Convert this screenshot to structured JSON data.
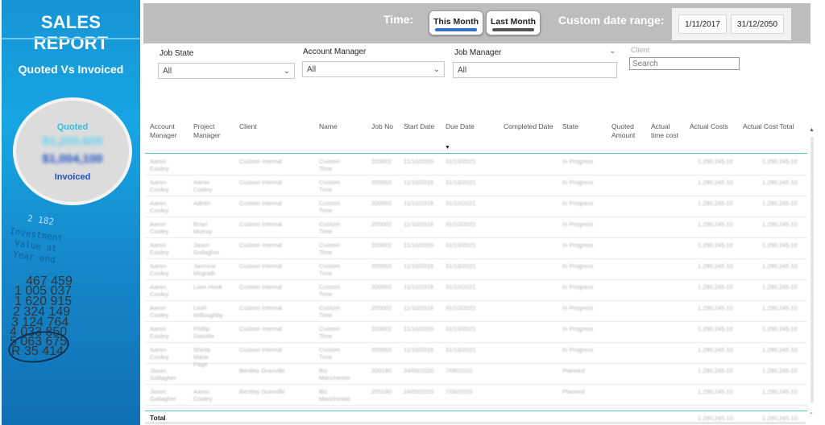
{
  "sidebar": {
    "title": "SALES REPORT",
    "subtitle": "Quoted Vs Invoiced",
    "kpi": {
      "quoted_label": "Quoted",
      "quoted_value": "$1,200,600",
      "invoiced_value": "$1,004,100",
      "invoiced_label": "Invoiced"
    },
    "deco_text": [
      "2 182",
      "Investment",
      "Value at",
      "Year end"
    ],
    "deco_numbers": [
      "467 459",
      "1 005 037",
      "1 620 915",
      "2 324 149",
      "3 124 764",
      "4 033 850",
      "5 063 675",
      "R 35 414"
    ]
  },
  "header": {
    "time_label": "Time:",
    "this_month": "This Month",
    "last_month": "Last Month",
    "custom_label": "Custom date range:",
    "date_from": "1/11/2017",
    "date_to": "31/12/2050"
  },
  "slicers": {
    "job_state": {
      "label": "Job State",
      "value": "All"
    },
    "account_manager": {
      "label": "Account Manager",
      "value": "All"
    },
    "job_manager": {
      "label": "Job Manager",
      "value": "All"
    },
    "client": {
      "label": "Client",
      "placeholder": "Search"
    }
  },
  "table": {
    "columns": [
      "Account Manager",
      "Project Manager",
      "Client",
      "Name",
      "Job No",
      "Start Date",
      "Due Date",
      "Completed Date",
      "State",
      "Quoted Amount",
      "Actual time cost",
      "Actual Costs",
      "Actual Cost Total"
    ],
    "rows": [
      [
        "Aaron Cooley",
        "",
        "Custom Internal",
        "Custom Time",
        "200002",
        "11/10/2016",
        "31/10/2021",
        "",
        "In Progress",
        "",
        "",
        "1,290,245.10",
        "1,290,245.10"
      ],
      [
        "Aaron Cooley",
        "Aaron Cooley",
        "Custom Internal",
        "Custom Time",
        "200002",
        "11/10/2016",
        "31/10/2021",
        "",
        "In Progress",
        "",
        "",
        "1,290,245.10",
        "1,290,245.10"
      ],
      [
        "Aaron Cooley",
        "Admin",
        "Custom Internal",
        "Custom Time",
        "200002",
        "11/10/2016",
        "31/10/2021",
        "",
        "In Progress",
        "",
        "",
        "1,290,245.10",
        "1,290,245.10"
      ],
      [
        "Aaron Cooley",
        "Brian Murray",
        "Custom Internal",
        "Custom Time",
        "200002",
        "11/10/2016",
        "31/10/2021",
        "",
        "In Progress",
        "",
        "",
        "1,290,245.10",
        "1,290,245.10"
      ],
      [
        "Aaron Cooley",
        "Jason Gallagher",
        "Custom Internal",
        "Custom Time",
        "200002",
        "11/10/2016",
        "31/10/2021",
        "",
        "In Progress",
        "",
        "",
        "1,290,245.10",
        "1,290,245.10"
      ],
      [
        "Aaron Cooley",
        "Jasmine Mcgrath",
        "Custom Internal",
        "Custom Time",
        "200002",
        "11/10/2016",
        "31/10/2021",
        "",
        "In Progress",
        "",
        "",
        "1,290,245.10",
        "1,290,245.10"
      ],
      [
        "Aaron Cooley",
        "Liam Hook",
        "Custom Internal",
        "Custom Time",
        "200002",
        "11/10/2016",
        "31/10/2021",
        "",
        "In Progress",
        "",
        "",
        "1,290,245.10",
        "1,290,245.10"
      ],
      [
        "Aaron Cooley",
        "Leah Willoughby",
        "Custom Internal",
        "Custom Time",
        "200002",
        "11/10/2016",
        "31/10/2021",
        "",
        "In Progress",
        "",
        "",
        "1,290,245.10",
        "1,290,245.10"
      ],
      [
        "Aaron Cooley",
        "Phillip Dakotla",
        "Custom Internal",
        "Custom Time",
        "200002",
        "11/10/2016",
        "31/10/2021",
        "",
        "In Progress",
        "",
        "",
        "1,290,245.10",
        "1,290,245.10"
      ],
      [
        "Aaron Cooley",
        "Sheila Marie Page",
        "Custom Internal",
        "Custom Time",
        "200002",
        "11/10/2016",
        "31/10/2021",
        "",
        "In Progress",
        "",
        "",
        "1,290,245.10",
        "1,290,245.10"
      ],
      [
        "Jason Gallagher",
        "",
        "Bentley Granville",
        "Biz Manchester",
        "200180",
        "24/05/2020",
        "7/06/2020",
        "",
        "Planned",
        "",
        "",
        "1,290,245.10",
        "1,290,245.10"
      ],
      [
        "Jason Gallagher",
        "Aaron Cooley",
        "Bentley Granville",
        "Biz Manchester",
        "200180",
        "24/05/2020",
        "7/06/2020",
        "",
        "Planned",
        "",
        "",
        "1,290,245.10",
        "1,290,245.10"
      ]
    ],
    "total_label": "Total",
    "total_values": [
      "1,290,245.10",
      "1,290,245.10"
    ]
  },
  "colors": {
    "sidebar_blue": "#1794d6",
    "header_gray": "#bdbdbd",
    "accent_blue": "#2f6fd8",
    "table_line": "#4fc3c3"
  },
  "icons": [
    "chevron-down-icon",
    "sort-down-icon",
    "scroll-up-icon",
    "scroll-down-icon"
  ]
}
